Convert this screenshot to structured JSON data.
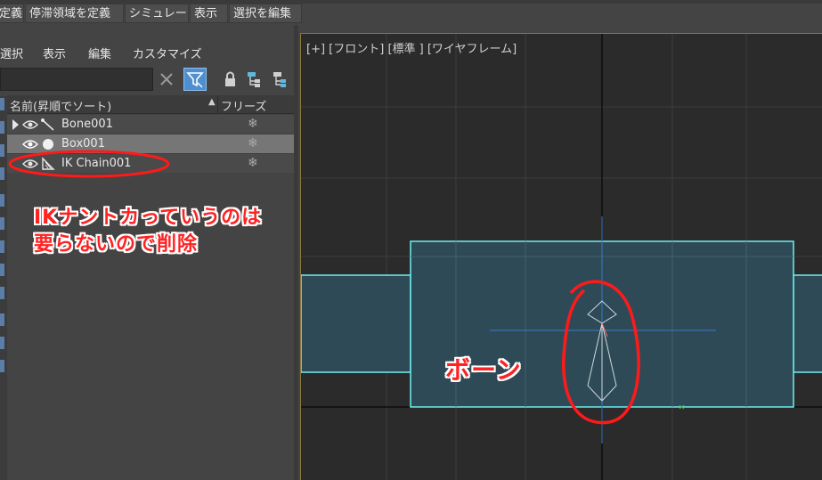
{
  "menubar": {
    "items": [
      "定義",
      "停滞領域を定義",
      "シミュレート",
      "表示",
      "選択を編集"
    ]
  },
  "explorer": {
    "menus": [
      "選択",
      "表示",
      "編集",
      "カスタマイズ"
    ],
    "search_value": "",
    "columns": {
      "name": "名前(昇順でソート)",
      "freeze": "フリーズ"
    },
    "rows": [
      {
        "label": "Bone001",
        "selected": false,
        "expandable": true,
        "type_icon": "bone-icon"
      },
      {
        "label": "Box001",
        "selected": true,
        "expandable": false,
        "type_icon": "sphere-icon"
      },
      {
        "label": "IK Chain001",
        "selected": false,
        "expandable": false,
        "type_icon": "ik-chain-icon"
      }
    ],
    "freeze_icon": "snowflake-icon"
  },
  "viewport": {
    "label": "[+] [フロント] [標準 ] [ワイヤフレーム]"
  },
  "annotations": {
    "ik_note_line1": "IKナントカっていうのは",
    "ik_note_line2": "要らないので削除",
    "bone_note": "ボーン",
    "color": "#ff2222"
  },
  "colors": {
    "selection_highlight": "#767676",
    "box_fill": "#2e4a57",
    "box_edge": "#6ff0f0",
    "filter_button": "#4f8fd0"
  }
}
